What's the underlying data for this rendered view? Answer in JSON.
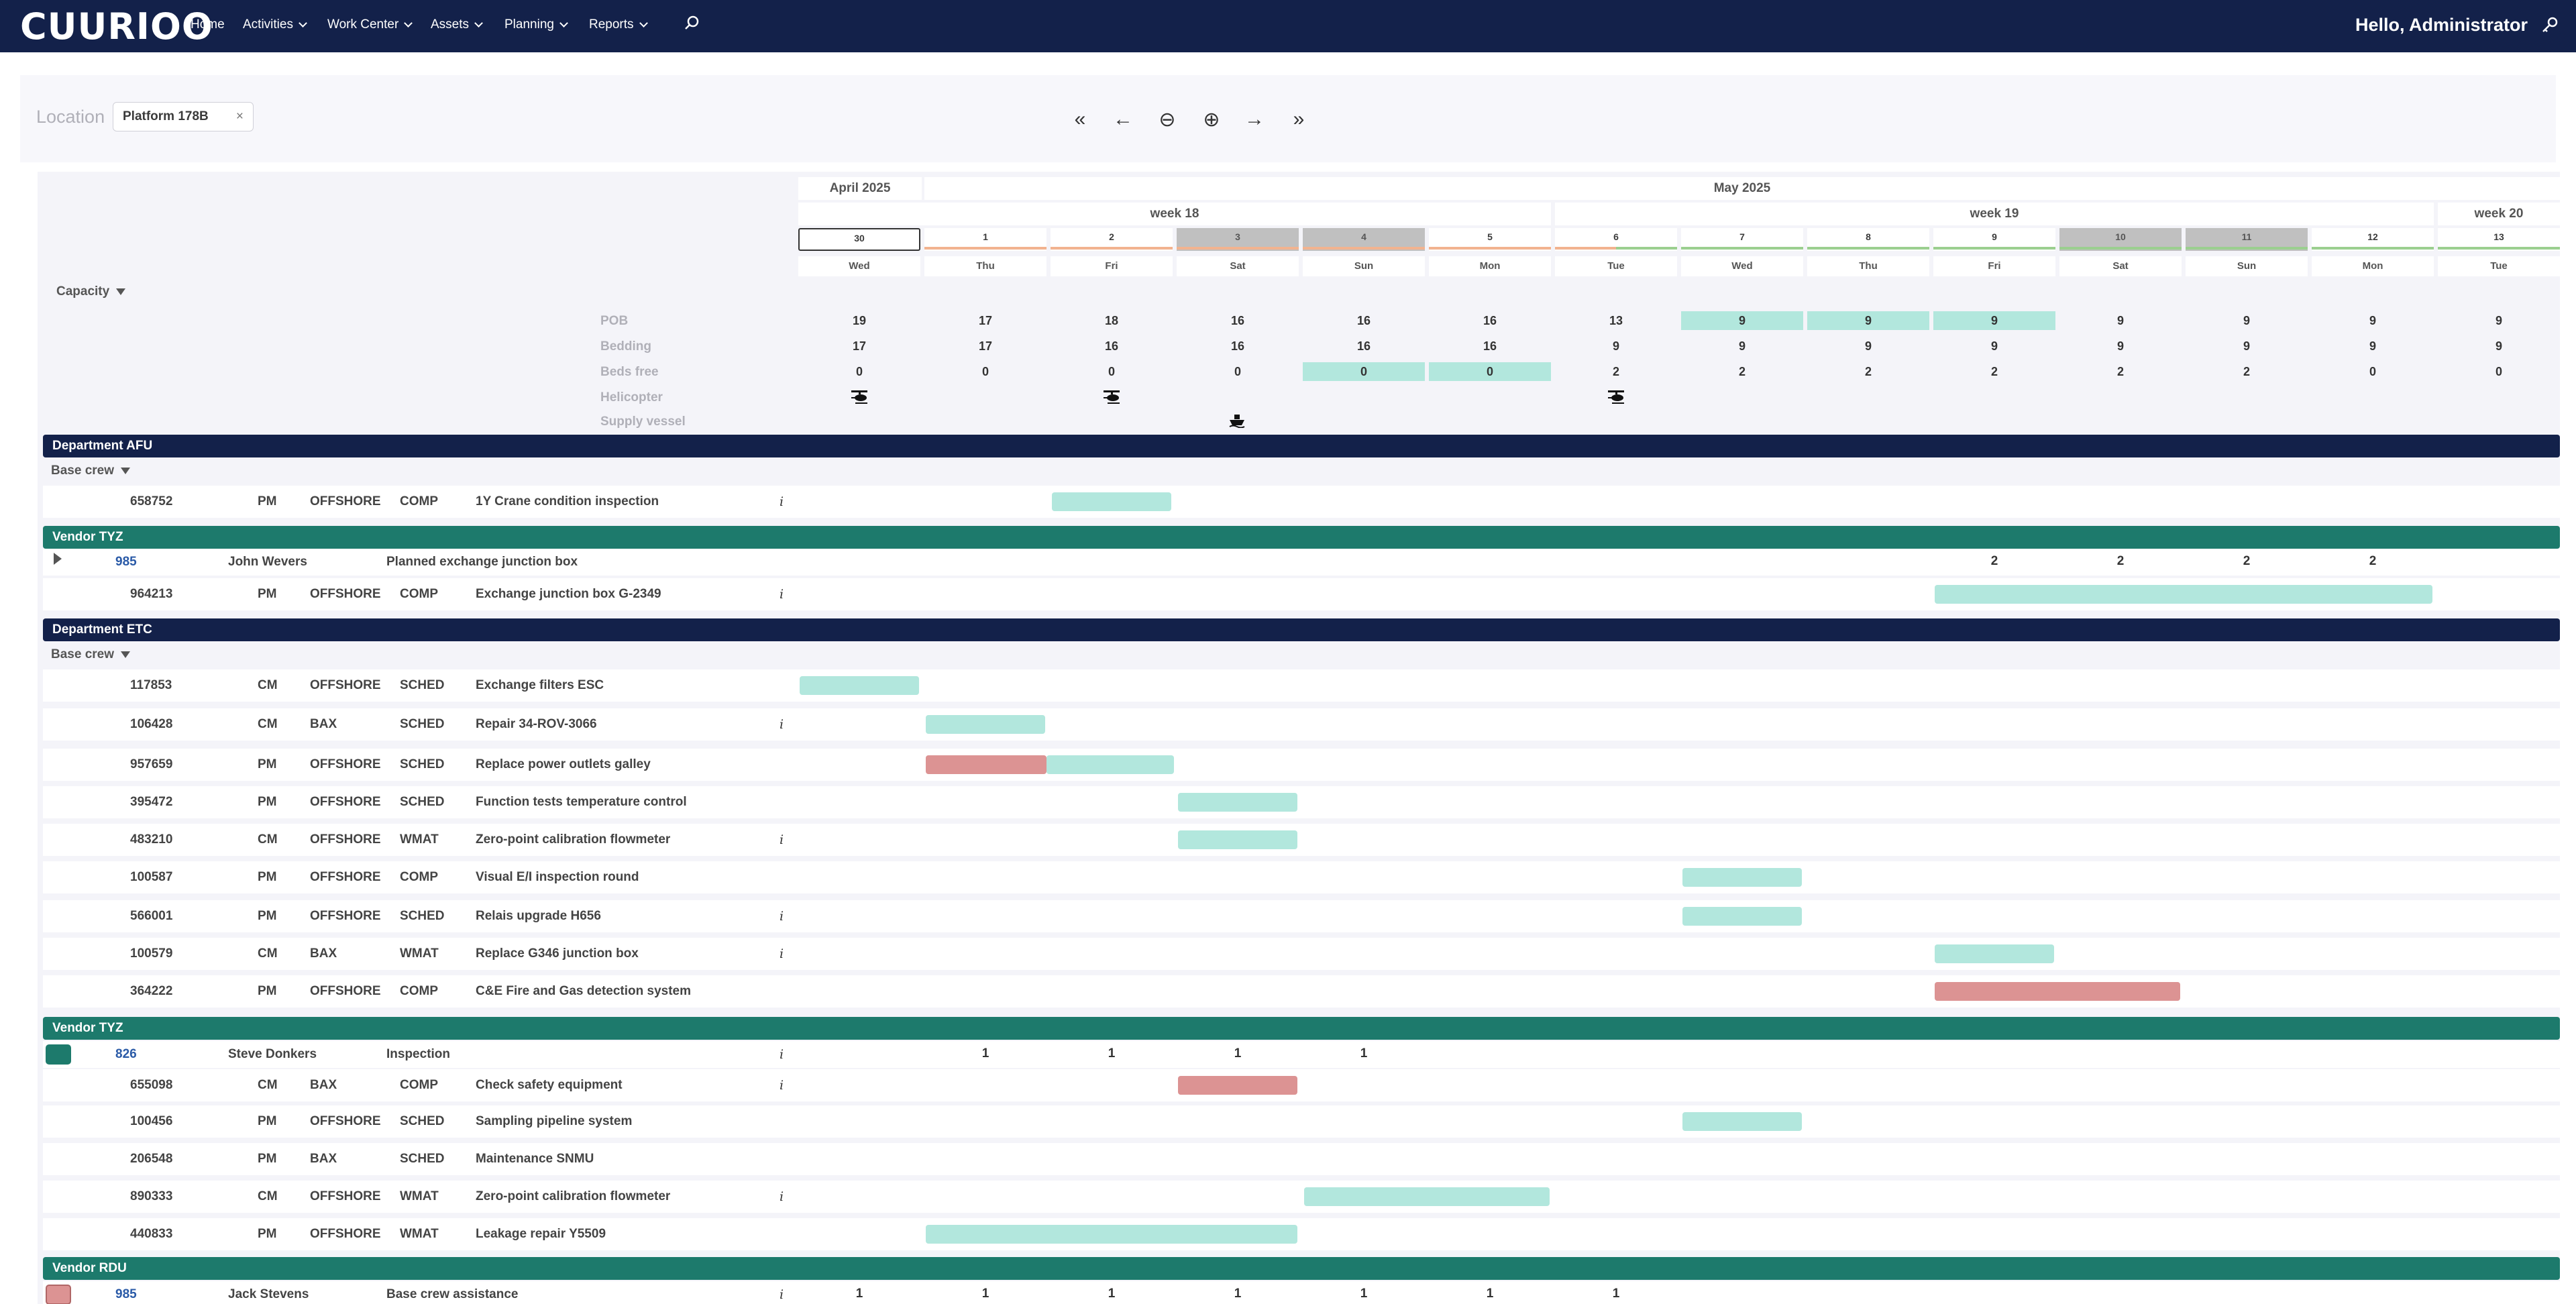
{
  "nav": {
    "logo": "CUURIOO",
    "items": [
      {
        "label": "Home",
        "dropdown": false
      },
      {
        "label": "Activities",
        "dropdown": true
      },
      {
        "label": "Work Center",
        "dropdown": true
      },
      {
        "label": "Assets",
        "dropdown": true
      },
      {
        "label": "Planning",
        "dropdown": true
      },
      {
        "label": "Reports",
        "dropdown": true
      }
    ],
    "search_icon": "search-icon",
    "greeting": "Hello, Administrator",
    "settings_icon": "key-icon"
  },
  "toolbar": {
    "location_label": "Location",
    "location_value": "Platform 178B",
    "location_clear": "×",
    "buttons": [
      {
        "name": "first-button",
        "glyph": "«"
      },
      {
        "name": "prev-button",
        "glyph": "←"
      },
      {
        "name": "zoom-out-button",
        "glyph": "⊖"
      },
      {
        "name": "zoom-in-button",
        "glyph": "⊕"
      },
      {
        "name": "next-button",
        "glyph": "→"
      },
      {
        "name": "last-button",
        "glyph": "»"
      }
    ]
  },
  "calendar": {
    "months": [
      "April 2025",
      "May 2025"
    ],
    "weeks": [
      "week 18",
      "week 19",
      "week 20"
    ],
    "days": [
      {
        "num": "30",
        "wd": "Wed",
        "weekend": false,
        "today": true,
        "status": "none"
      },
      {
        "num": "1",
        "wd": "Thu",
        "weekend": false,
        "today": false,
        "status": "orange"
      },
      {
        "num": "2",
        "wd": "Fri",
        "weekend": false,
        "today": false,
        "status": "orange"
      },
      {
        "num": "3",
        "wd": "Sat",
        "weekend": true,
        "today": false,
        "status": "orange"
      },
      {
        "num": "4",
        "wd": "Sun",
        "weekend": true,
        "today": false,
        "status": "orange"
      },
      {
        "num": "5",
        "wd": "Mon",
        "weekend": false,
        "today": false,
        "status": "orange"
      },
      {
        "num": "6",
        "wd": "Tue",
        "weekend": false,
        "today": false,
        "status": "mixed"
      },
      {
        "num": "7",
        "wd": "Wed",
        "weekend": false,
        "today": false,
        "status": "green"
      },
      {
        "num": "8",
        "wd": "Thu",
        "weekend": false,
        "today": false,
        "status": "green"
      },
      {
        "num": "9",
        "wd": "Fri",
        "weekend": false,
        "today": false,
        "status": "green"
      },
      {
        "num": "10",
        "wd": "Sat",
        "weekend": true,
        "today": false,
        "status": "green"
      },
      {
        "num": "11",
        "wd": "Sun",
        "weekend": true,
        "today": false,
        "status": "green"
      },
      {
        "num": "12",
        "wd": "Mon",
        "weekend": false,
        "today": false,
        "status": "green"
      },
      {
        "num": "13",
        "wd": "Tue",
        "weekend": false,
        "today": false,
        "status": "green"
      }
    ],
    "status_colors": {
      "orange": "#f2b38f",
      "green": "#9bcf8f"
    }
  },
  "capacity": {
    "title": "Capacity",
    "rows": [
      {
        "label": "POB",
        "values": [
          "19",
          "17",
          "18",
          "16",
          "16",
          "16",
          "13",
          "9",
          "9",
          "9",
          "9",
          "9",
          "9",
          "9"
        ],
        "highlight": [
          7,
          8,
          9
        ]
      },
      {
        "label": "Bedding",
        "values": [
          "17",
          "17",
          "16",
          "16",
          "16",
          "16",
          "9",
          "9",
          "9",
          "9",
          "9",
          "9",
          "9",
          "9"
        ],
        "highlight": []
      },
      {
        "label": "Beds free",
        "values": [
          "0",
          "0",
          "0",
          "0",
          "0",
          "0",
          "2",
          "2",
          "2",
          "2",
          "2",
          "2",
          "0",
          "0"
        ],
        "highlight": [
          4,
          5
        ]
      },
      {
        "label": "Helicopter",
        "icons": [
          0,
          2,
          6
        ]
      },
      {
        "label": "Supply vessel",
        "icons": [
          3
        ]
      }
    ]
  },
  "sections": {
    "dept_afu": "Department AFU",
    "base_crew_1": "Base crew",
    "vendor_tyz_1": "Vendor TYZ",
    "dept_etc": "Department ETC",
    "base_crew_2": "Base crew",
    "vendor_tyz_2": "Vendor TYZ",
    "vendor_rdu": "Vendor RDU"
  },
  "afu_rows": [
    {
      "id": "658752",
      "type": "PM",
      "loc": "OFFSHORE",
      "status": "COMP",
      "desc": "1Y Crane condition inspection",
      "info": "i"
    }
  ],
  "tyz1_group": {
    "id": "985",
    "person": "John Wevers",
    "desc": "Planned exchange junction box",
    "counts": [
      "2",
      "2",
      "2",
      "2"
    ]
  },
  "tyz1_rows": [
    {
      "id": "964213",
      "type": "PM",
      "loc": "OFFSHORE",
      "status": "COMP",
      "desc": "Exchange junction box G-2349",
      "info": "i"
    }
  ],
  "etc_rows": [
    {
      "id": "117853",
      "type": "CM",
      "loc": "OFFSHORE",
      "status": "SCHED",
      "desc": "Exchange filters ESC",
      "info": ""
    },
    {
      "id": "106428",
      "type": "CM",
      "loc": "BAX",
      "status": "SCHED",
      "desc": "Repair 34-ROV-3066",
      "info": "i"
    },
    {
      "id": "957659",
      "type": "PM",
      "loc": "OFFSHORE",
      "status": "SCHED",
      "desc": "Replace power outlets galley",
      "info": ""
    },
    {
      "id": "395472",
      "type": "PM",
      "loc": "OFFSHORE",
      "status": "SCHED",
      "desc": "Function tests temperature control",
      "info": ""
    },
    {
      "id": "483210",
      "type": "CM",
      "loc": "OFFSHORE",
      "status": "WMAT",
      "desc": "Zero-point calibration flowmeter",
      "info": "i"
    },
    {
      "id": "100587",
      "type": "PM",
      "loc": "OFFSHORE",
      "status": "COMP",
      "desc": "Visual E/I inspection round",
      "info": ""
    },
    {
      "id": "566001",
      "type": "PM",
      "loc": "OFFSHORE",
      "status": "SCHED",
      "desc": "Relais upgrade H656",
      "info": "i"
    },
    {
      "id": "100579",
      "type": "CM",
      "loc": "BAX",
      "status": "WMAT",
      "desc": "Replace G346 junction box",
      "info": "i"
    },
    {
      "id": "364222",
      "type": "PM",
      "loc": "OFFSHORE",
      "status": "COMP",
      "desc": "C&E Fire and Gas detection system",
      "info": ""
    }
  ],
  "tyz2_group": {
    "id": "826",
    "person": "Steve Donkers",
    "desc": "Inspection",
    "info": "i",
    "counts": [
      "1",
      "1",
      "1",
      "1"
    ]
  },
  "tyz2_rows": [
    {
      "id": "655098",
      "type": "CM",
      "loc": "BAX",
      "status": "COMP",
      "desc": "Check safety equipment",
      "info": "i"
    },
    {
      "id": "100456",
      "type": "PM",
      "loc": "OFFSHORE",
      "status": "SCHED",
      "desc": "Sampling pipeline system",
      "info": ""
    },
    {
      "id": "206548",
      "type": "PM",
      "loc": "BAX",
      "status": "SCHED",
      "desc": "Maintenance SNMU",
      "info": ""
    },
    {
      "id": "890333",
      "type": "CM",
      "loc": "OFFSHORE",
      "status": "WMAT",
      "desc": "Zero-point calibration flowmeter",
      "info": "i"
    },
    {
      "id": "440833",
      "type": "PM",
      "loc": "OFFSHORE",
      "status": "WMAT",
      "desc": "Leakage repair Y5509",
      "info": ""
    }
  ],
  "rdu_group": {
    "id": "985",
    "person": "Jack Stevens",
    "desc": "Base crew assistance",
    "info": "i",
    "counts": [
      "1",
      "1",
      "1",
      "1",
      "1",
      "1",
      "1"
    ]
  },
  "colors": {
    "nav": "#13214a",
    "vendor": "#1d7a6c",
    "bar_ok": "#b2e7dd",
    "bar_late": "#dc9393"
  }
}
